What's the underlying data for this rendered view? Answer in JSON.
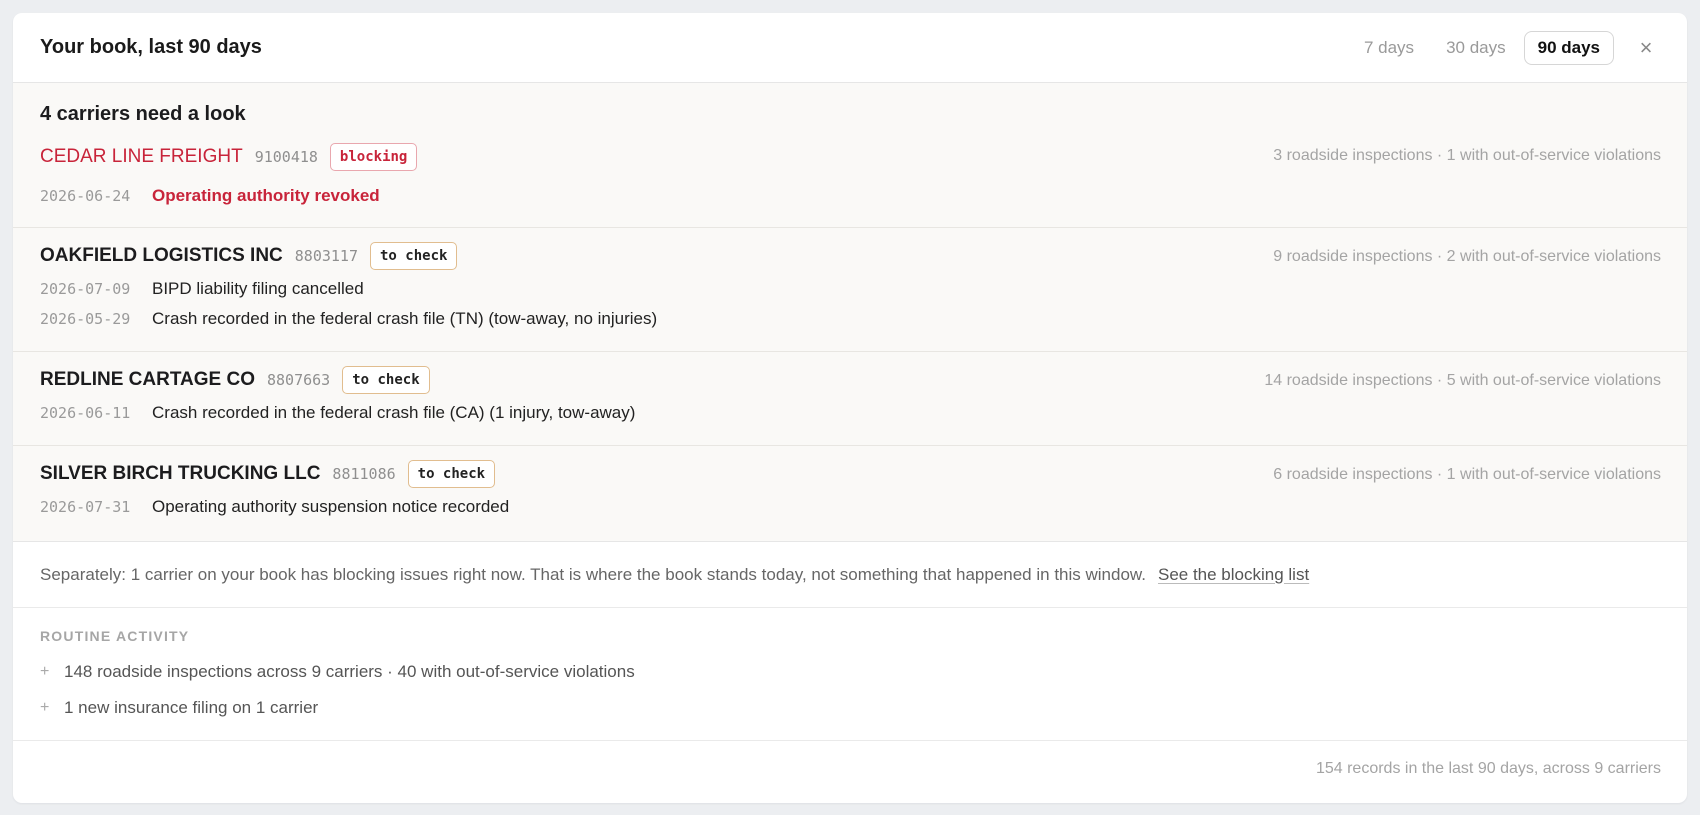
{
  "header": {
    "title": "Your book, last 90 days",
    "tabs": [
      "7 days",
      "30 days",
      "90 days"
    ],
    "active_tab": "90 days",
    "close_glyph": "×"
  },
  "alerts": {
    "heading": "4 carriers need a look",
    "carriers": [
      {
        "name": "CEDAR LINE FREIGHT",
        "number": "9100418",
        "badge": "blocking",
        "stat": "3 roadside inspections · 1 with out-of-service violations",
        "events": [
          {
            "date": "2026-06-24",
            "text": "Operating authority revoked"
          }
        ]
      },
      {
        "name": "OAKFIELD LOGISTICS INC",
        "number": "8803117",
        "badge": "to check",
        "stat": "9 roadside inspections · 2 with out-of-service violations",
        "events": [
          {
            "date": "2026-07-09",
            "text": "BIPD liability filing cancelled"
          },
          {
            "date": "2026-05-29",
            "text": "Crash recorded in the federal crash file (TN) (tow-away, no injuries)"
          }
        ]
      },
      {
        "name": "REDLINE CARTAGE CO",
        "number": "8807663",
        "badge": "to check",
        "stat": "14 roadside inspections · 5 with out-of-service violations",
        "events": [
          {
            "date": "2026-06-11",
            "text": "Crash recorded in the federal crash file (CA) (1 injury, tow-away)"
          }
        ]
      },
      {
        "name": "SILVER BIRCH TRUCKING LLC",
        "number": "8811086",
        "badge": "to check",
        "stat": "6 roadside inspections · 1 with out-of-service violations",
        "events": [
          {
            "date": "2026-07-31",
            "text": "Operating authority suspension notice recorded"
          }
        ]
      }
    ]
  },
  "separately": {
    "text": "Separately: 1 carrier on your book has blocking issues right now. That is where the book stands today, not something that happened in this window.",
    "link": "See the blocking list"
  },
  "routine": {
    "heading": "ROUTINE ACTIVITY",
    "items": [
      "148 roadside inspections across 9 carriers · 40 with out-of-service violations",
      "1 new insurance filing on 1 carrier"
    ],
    "bullet": "+"
  },
  "footer": {
    "text": "154 records in the last 90 days, across 9 carriers"
  },
  "colors": {
    "blocking": "#c8243a",
    "to_check_border": "#e1bd8f",
    "alert_bg": "#faf9f7"
  }
}
